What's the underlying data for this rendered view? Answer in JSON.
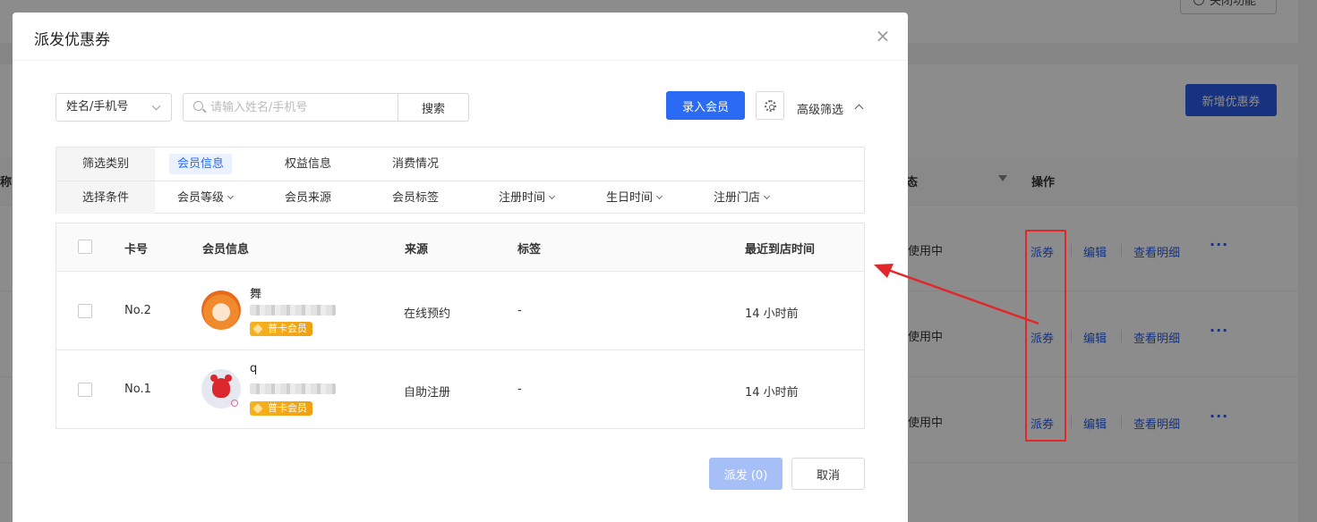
{
  "background": {
    "top_button": "关闭功能",
    "new_coupon_button": "新增优惠券",
    "header_left": "称",
    "header_status": "态",
    "header_actions": "操作",
    "rows": [
      {
        "status": "使用中",
        "dispatch": "派券",
        "edit": "编辑",
        "detail": "查看明细",
        "more": "···"
      },
      {
        "status": "使用中",
        "dispatch": "派券",
        "edit": "编辑",
        "detail": "查看明细",
        "more": "···"
      },
      {
        "status": "使用中",
        "dispatch": "派券",
        "edit": "编辑",
        "detail": "查看明细",
        "more": "···"
      }
    ]
  },
  "modal": {
    "title": "派发优惠券",
    "close_label": "×",
    "toolbar": {
      "search_type": "姓名/手机号",
      "search_placeholder": "请输入姓名/手机号",
      "search_button": "搜索",
      "add_member_button": "录入会员",
      "advanced_filter": "高级筛选"
    },
    "filters": {
      "category_label": "筛选类别",
      "categories": [
        {
          "label": "会员信息",
          "active": true
        },
        {
          "label": "权益信息",
          "active": false
        },
        {
          "label": "消费情况",
          "active": false
        }
      ],
      "condition_label": "选择条件",
      "conditions": [
        {
          "label": "会员等级",
          "dropdown": true
        },
        {
          "label": "会员来源",
          "dropdown": false
        },
        {
          "label": "会员标签",
          "dropdown": false
        },
        {
          "label": "注册时间",
          "dropdown": true
        },
        {
          "label": "生日时间",
          "dropdown": true
        },
        {
          "label": "注册门店",
          "dropdown": true
        }
      ]
    },
    "table": {
      "columns": [
        "卡号",
        "会员信息",
        "来源",
        "标签",
        "最近到店时间"
      ],
      "rows": [
        {
          "card_no": "No.2",
          "name": "舞",
          "badge": "普卡会员",
          "source": "在线预约",
          "tag": "-",
          "last_visit": "14 小时前"
        },
        {
          "card_no": "No.1",
          "name": "q",
          "badge": "普卡会员",
          "source": "自助注册",
          "tag": "-",
          "last_visit": "14 小时前"
        }
      ]
    },
    "footer": {
      "dispatch_button": "派发 (0)",
      "cancel_button": "取消"
    }
  },
  "annotation": {
    "highlight_color": "#e2272b"
  }
}
